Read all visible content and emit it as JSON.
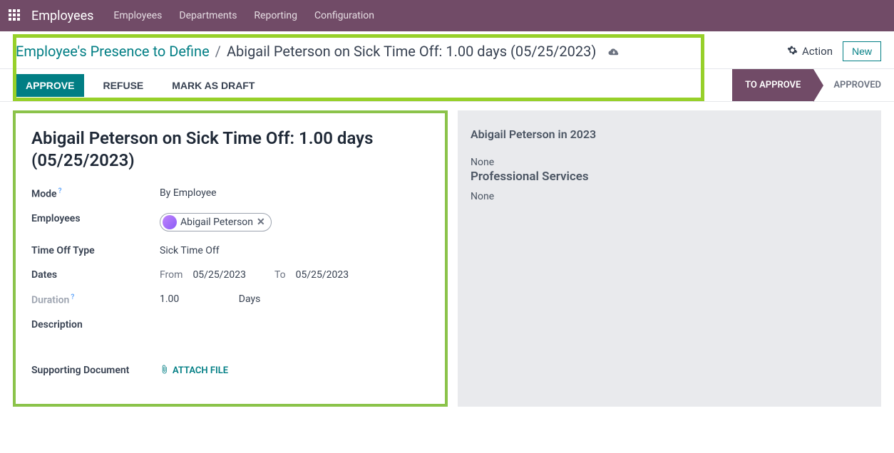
{
  "topbar": {
    "app_title": "Employees",
    "nav": [
      "Employees",
      "Departments",
      "Reporting",
      "Configuration"
    ]
  },
  "breadcrumb": {
    "link": "Employee's Presence to Define",
    "current": "Abigail Peterson on Sick Time Off: 1.00 days (05/25/2023)"
  },
  "actions": {
    "action_label": "Action",
    "new_label": "New"
  },
  "status": {
    "approve": "APPROVE",
    "refuse": "REFUSE",
    "draft": "MARK AS DRAFT",
    "stage_active": "TO APPROVE",
    "stage_next": "APPROVED"
  },
  "form": {
    "title": "Abigail Peterson on Sick Time Off: 1.00 days (05/25/2023)",
    "mode_label": "Mode",
    "mode_value": "By Employee",
    "employees_label": "Employees",
    "employee_tag": "Abigail Peterson",
    "type_label": "Time Off Type",
    "type_value": "Sick Time Off",
    "dates_label": "Dates",
    "from_label": "From",
    "from_value": "05/25/2023",
    "to_label": "To",
    "to_value": "05/25/2023",
    "duration_label": "Duration",
    "duration_value": "1.00",
    "duration_unit": "Days",
    "description_label": "Description",
    "supporting_label": "Supporting Document",
    "attach_label": "ATTACH FILE"
  },
  "side": {
    "title": "Abigail Peterson in 2023",
    "line1": "None",
    "line2": "Professional Services",
    "line3": "None"
  }
}
